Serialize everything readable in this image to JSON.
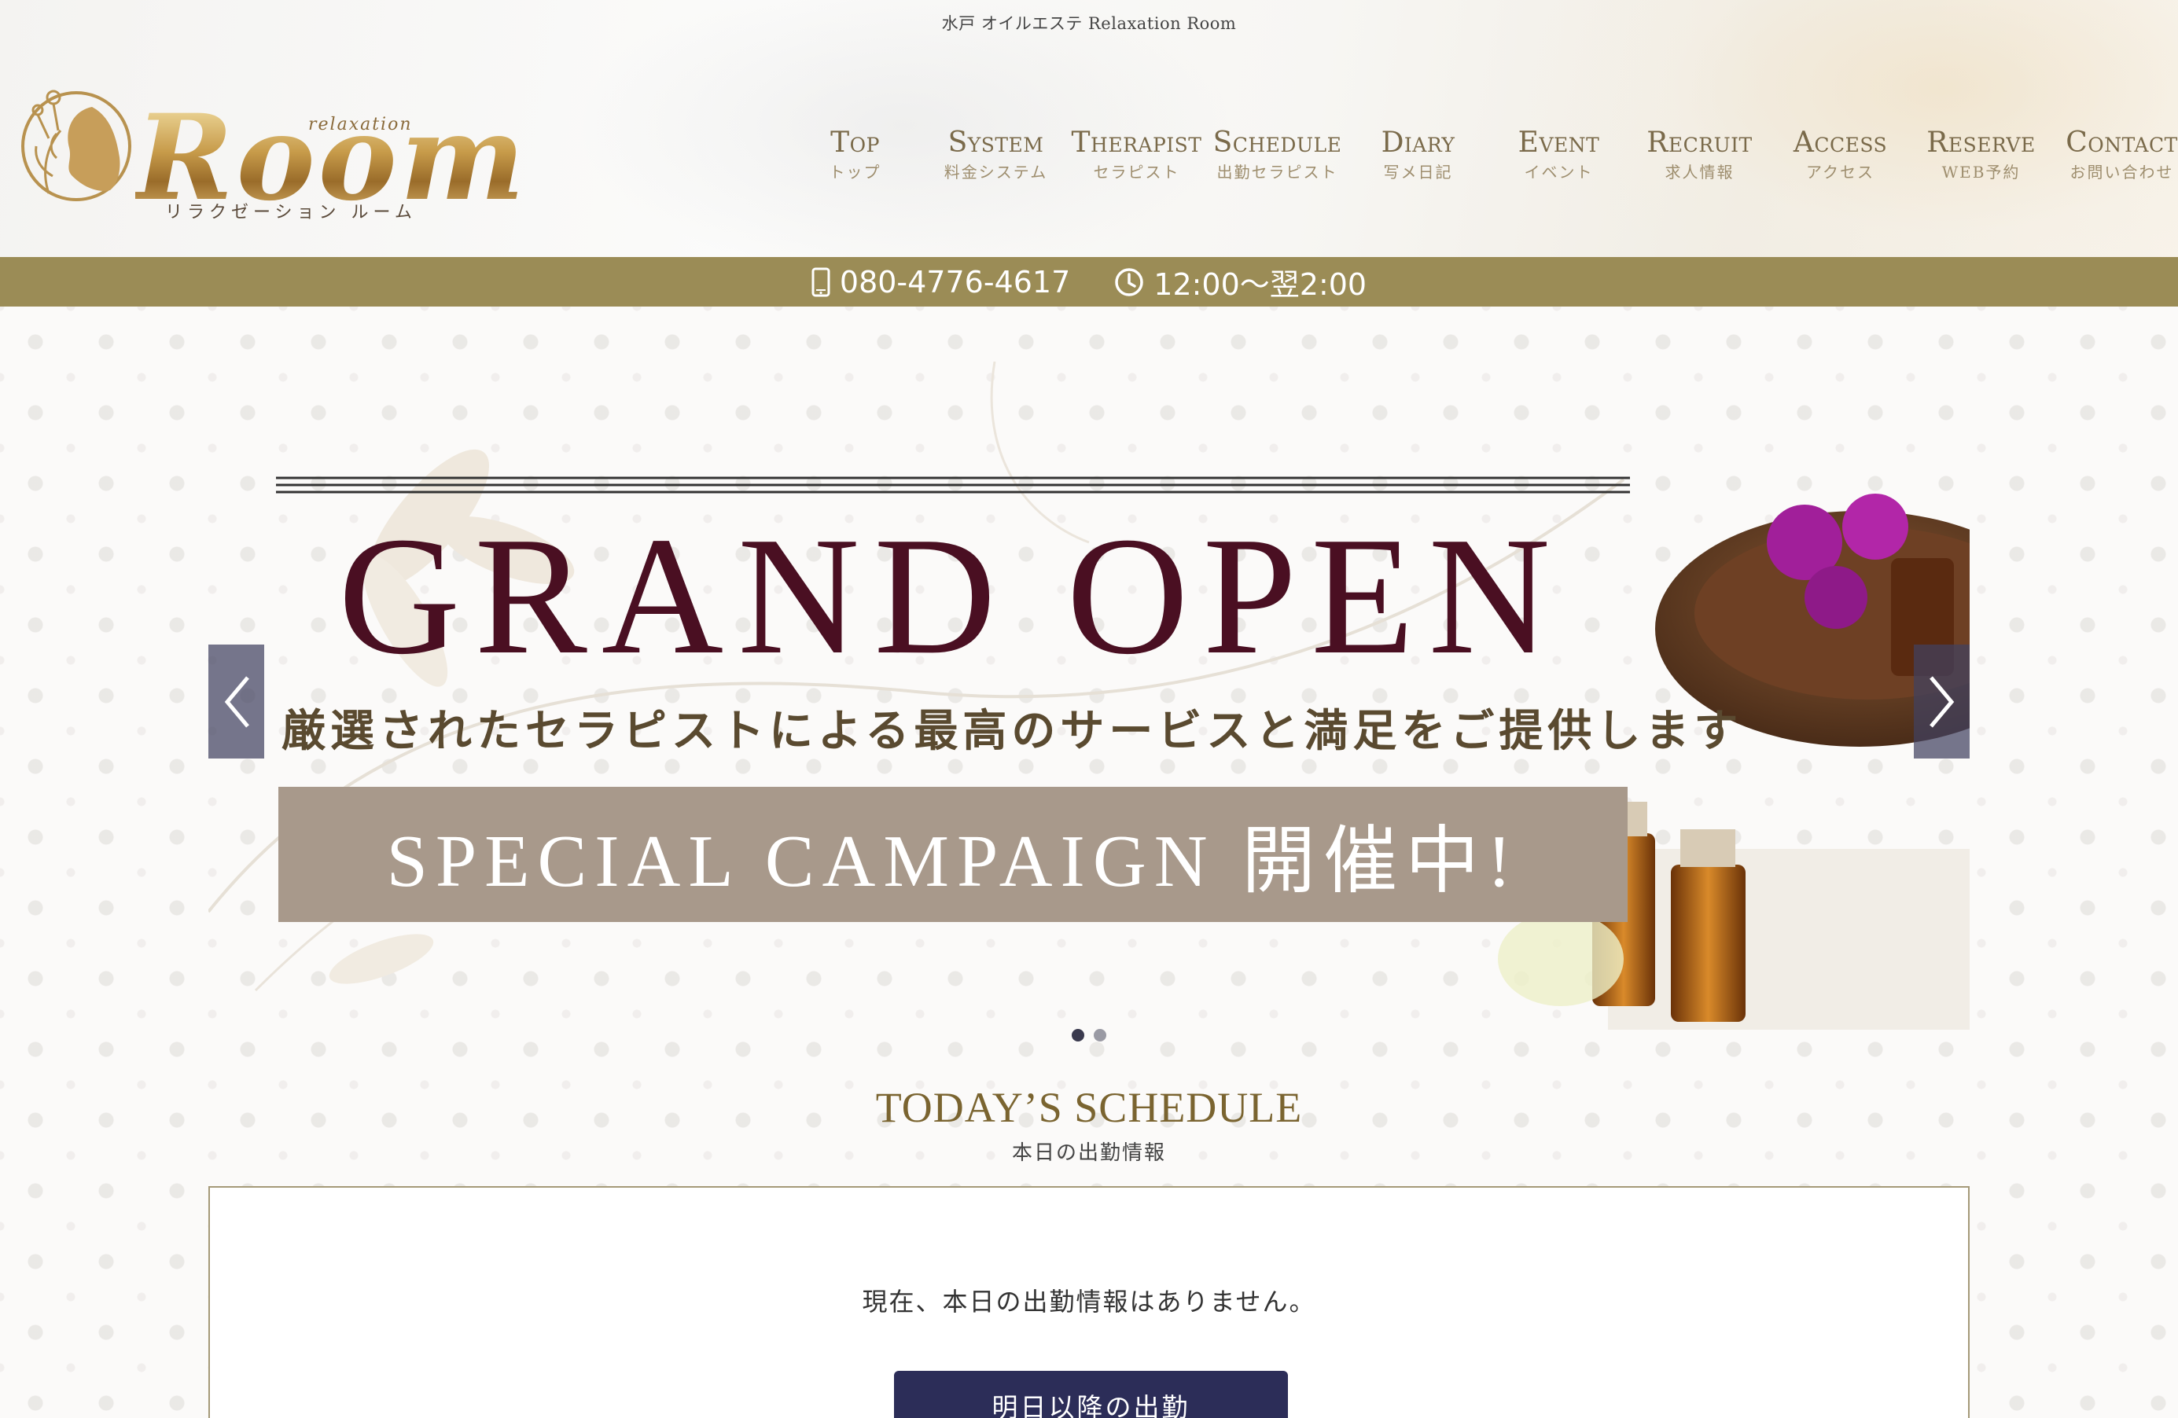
{
  "header": {
    "tagline": "水戸 オイルエステ Relaxation Room",
    "logo": {
      "sub": "relaxation",
      "main": "Room",
      "kana": "リラクゼーション ルーム"
    },
    "nav": [
      {
        "en": "Top",
        "jp": "トップ"
      },
      {
        "en": "System",
        "jp": "料金システム"
      },
      {
        "en": "Therapist",
        "jp": "セラピスト"
      },
      {
        "en": "Schedule",
        "jp": "出勤セラピスト"
      },
      {
        "en": "Diary",
        "jp": "写メ日記"
      },
      {
        "en": "Event",
        "jp": "イベント"
      },
      {
        "en": "Recruit",
        "jp": "求人情報"
      },
      {
        "en": "Access",
        "jp": "アクセス"
      },
      {
        "en": "Reserve",
        "jp": "WEB予約"
      },
      {
        "en": "Contact",
        "jp": "お問い合わせ"
      }
    ]
  },
  "infobar": {
    "phone": "080-4776-4617",
    "hours": "12:00～翌2:00",
    "phone_icon": "smartphone-icon",
    "hours_icon": "clock-icon"
  },
  "slider": {
    "title": "GRAND OPEN",
    "subtitle": "厳選されたセラピストによる最高のサービスと満足をご提供します",
    "banner": "SPECIAL CAMPAIGN 開催中!",
    "current_slide": 1,
    "slide_count": 2
  },
  "schedule": {
    "title": "TODAY’S SCHEDULE",
    "subtitle": "本日の出勤情報",
    "message": "現在、本日の出勤情報はありません。",
    "button": "明日以降の出勤"
  },
  "colors": {
    "bar": "#9b8c56",
    "nav_text": "#7a6a4a",
    "title_wine": "#4a0f22",
    "button": "#2c2d58"
  }
}
